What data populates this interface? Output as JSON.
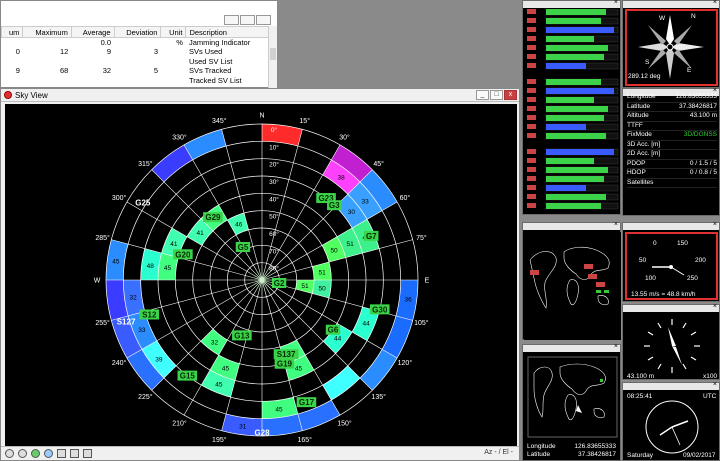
{
  "table": {
    "headers": [
      "um",
      "Maximum",
      "Average",
      "Deviation",
      "Unit",
      "Description"
    ],
    "rows": [
      [
        "",
        "",
        "0.0",
        "",
        "%",
        "Jamming Indicator"
      ],
      [
        "0",
        "12",
        "9",
        "3",
        "",
        "SVs Used"
      ],
      [
        "",
        "",
        "",
        "",
        "",
        "Used SV List"
      ],
      [
        "9",
        "68",
        "32",
        "5",
        "",
        "SVs Tracked"
      ],
      [
        "",
        "",
        "",
        "",
        "",
        "Tracked SV List"
      ]
    ]
  },
  "sky": {
    "title": "Sky View",
    "north": "N",
    "east": "E",
    "west": "W",
    "status": "Az - / El -",
    "azimuth_labels": [
      "15°",
      "30°",
      "45°",
      "60°",
      "75°",
      "105°",
      "120°",
      "135°",
      "150°",
      "165°",
      "195°",
      "210°",
      "225°",
      "240°",
      "255°",
      "285°",
      "300°",
      "315°",
      "330°",
      "345°"
    ],
    "elevation_labels": [
      "0°",
      "10°",
      "20°",
      "30°",
      "40°",
      "50°",
      "60°",
      "70°",
      "80°"
    ],
    "satellites": [
      {
        "id": "G23",
        "az": 38,
        "el": 30
      },
      {
        "id": "G3",
        "az": 44,
        "el": 30
      },
      {
        "id": "G7",
        "az": 68,
        "el": 22
      },
      {
        "id": "G29",
        "az": 322,
        "el": 44
      },
      {
        "id": "G25",
        "az": 303,
        "el": 8
      },
      {
        "id": "G5",
        "az": 330,
        "el": 68
      },
      {
        "id": "G20",
        "az": 288,
        "el": 42
      },
      {
        "id": "G2",
        "az": 100,
        "el": 80
      },
      {
        "id": "S127",
        "az": 253,
        "el": 8
      },
      {
        "id": "S12",
        "az": 253,
        "el": 22
      },
      {
        "id": "G30",
        "az": 104,
        "el": 20
      },
      {
        "id": "G6",
        "az": 125,
        "el": 40
      },
      {
        "id": "G13",
        "az": 200,
        "el": 56
      },
      {
        "id": "S137",
        "az": 162,
        "el": 45
      },
      {
        "id": "G19",
        "az": 165,
        "el": 40
      },
      {
        "id": "G15",
        "az": 218,
        "el": 20
      },
      {
        "id": "G17",
        "az": 160,
        "el": 15
      },
      {
        "id": "G28",
        "az": 180,
        "el": 2
      }
    ],
    "cells": [
      {
        "az": 0,
        "ring": 0,
        "color": "#ff2a2a",
        "label": ""
      },
      {
        "az": 30,
        "ring": 0,
        "color": "#c020d0",
        "label": ""
      },
      {
        "az": 30,
        "ring": 1,
        "color": "#ff40ff",
        "label": "38"
      },
      {
        "az": 45,
        "ring": 0,
        "color": "#2a8cff",
        "label": ""
      },
      {
        "az": 45,
        "ring": 1,
        "color": "#3aa0ff",
        "label": "33"
      },
      {
        "az": 60,
        "ring": 2,
        "color": "#3cf08c",
        "label": "47"
      },
      {
        "az": 60,
        "ring": 3,
        "color": "#3cf08c",
        "label": "51"
      },
      {
        "az": 60,
        "ring": 4,
        "color": "#50ff60",
        "label": "50"
      },
      {
        "az": 45,
        "ring": 2,
        "color": "#3aa0ff",
        "label": "30"
      },
      {
        "az": 75,
        "ring": 5,
        "color": "#50ff60",
        "label": "51"
      },
      {
        "az": 90,
        "ring": 6,
        "color": "#50ff60",
        "label": "51"
      },
      {
        "az": 90,
        "ring": 5,
        "color": "#40f0a0",
        "label": "50"
      },
      {
        "az": 90,
        "ring": 0,
        "color": "#1a6cff",
        "label": "36"
      },
      {
        "az": 105,
        "ring": 0,
        "color": "#1a6cff",
        "label": ""
      },
      {
        "az": 105,
        "ring": 2,
        "color": "#2affd0",
        "label": "44"
      },
      {
        "az": 120,
        "ring": 3,
        "color": "#2affd0",
        "label": "44"
      },
      {
        "az": 120,
        "ring": 0,
        "color": "#2a8cff",
        "label": ""
      },
      {
        "az": 135,
        "ring": 1,
        "color": "#40ffff",
        "label": ""
      },
      {
        "az": 150,
        "ring": 0,
        "color": "#2a70ff",
        "label": ""
      },
      {
        "az": 150,
        "ring": 3,
        "color": "#40ff80",
        "label": "45"
      },
      {
        "az": 150,
        "ring": 4,
        "color": "#40ff80",
        "label": "46"
      },
      {
        "az": 165,
        "ring": 1,
        "color": "#40ff80",
        "label": "45"
      },
      {
        "az": 165,
        "ring": 0,
        "color": "#2a70ff",
        "label": ""
      },
      {
        "az": 180,
        "ring": 0,
        "color": "#3a5cff",
        "label": "31"
      },
      {
        "az": 195,
        "ring": 2,
        "color": "#40ffb0",
        "label": "45"
      },
      {
        "az": 195,
        "ring": 3,
        "color": "#40ff80",
        "label": "45"
      },
      {
        "az": 210,
        "ring": 4,
        "color": "#40ff80",
        "label": "32"
      },
      {
        "az": 225,
        "ring": 1,
        "color": "#40ffff",
        "label": "39"
      },
      {
        "az": 225,
        "ring": 0,
        "color": "#2a70ff",
        "label": ""
      },
      {
        "az": 240,
        "ring": 0,
        "color": "#3a5cff",
        "label": ""
      },
      {
        "az": 240,
        "ring": 1,
        "color": "#2a8cff",
        "label": "33"
      },
      {
        "az": 255,
        "ring": 0,
        "color": "#3a3cff",
        "label": ""
      },
      {
        "az": 255,
        "ring": 1,
        "color": "#3a70ff",
        "label": "32"
      },
      {
        "az": 270,
        "ring": 0,
        "color": "#2a8cff",
        "label": "45"
      },
      {
        "az": 270,
        "ring": 3,
        "color": "#40ff80",
        "label": "45"
      },
      {
        "az": 270,
        "ring": 2,
        "color": "#2affd0",
        "label": "48"
      },
      {
        "az": 285,
        "ring": 3,
        "color": "#40ffb0",
        "label": "41"
      },
      {
        "az": 300,
        "ring": 4,
        "color": "#40ffb0",
        "label": "41"
      },
      {
        "az": 315,
        "ring": 0,
        "color": "#3a3cff",
        "label": ""
      },
      {
        "az": 330,
        "ring": 0,
        "color": "#2a8cff",
        "label": ""
      },
      {
        "az": 330,
        "ring": 5,
        "color": "#40ffb0",
        "label": "46"
      },
      {
        "az": 315,
        "ring": 4,
        "color": "#40ff80",
        "label": "41"
      }
    ]
  },
  "compass": {
    "heading": "289.12 deg",
    "n": "N",
    "w": "W",
    "e": "E",
    "s": "S"
  },
  "info": {
    "rows": [
      [
        "Longitude",
        "126.83655333"
      ],
      [
        "Latitude",
        "37.38426817"
      ],
      [
        "Altitude",
        "43.100 m"
      ],
      [
        "TTFF",
        ""
      ],
      [
        "FixMode",
        "3D/DGNSS"
      ],
      [
        "3D Acc. [m]",
        ""
      ],
      [
        "2D Acc. [m]",
        ""
      ],
      [
        "PDOP",
        "0 / 1.5 / 5"
      ],
      [
        "HDOP",
        "0 / 0.8 / 5"
      ],
      [
        "Satellites",
        ""
      ]
    ]
  },
  "speed": {
    "ticks": [
      "0",
      "50",
      "100",
      "150",
      "200",
      "250"
    ],
    "readout": "13.55 m/s = 48.8 km/h"
  },
  "altclock": {
    "left": "43.100 m",
    "right": "x100"
  },
  "utcclock": {
    "time": "08:25:41",
    "label": "UTC",
    "day": "Saturday",
    "date": "09/02/2017"
  },
  "map": {
    "lon_label": "Longitude",
    "lon": "126.83655333",
    "lat_label": "Latitude",
    "lat": "37.38426817"
  }
}
